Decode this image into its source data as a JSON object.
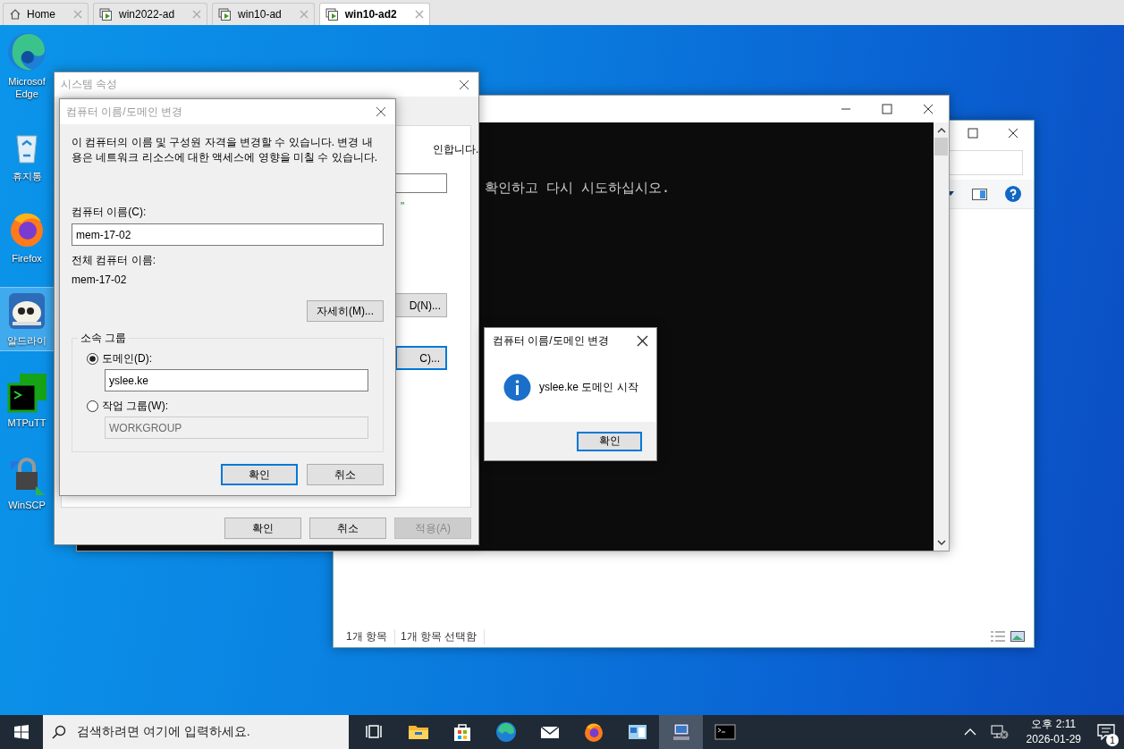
{
  "tabs": [
    {
      "label": "Home",
      "kind": "home",
      "selected": false
    },
    {
      "label": "win2022-ad",
      "kind": "vm",
      "selected": false
    },
    {
      "label": "win10-ad",
      "kind": "vm",
      "selected": false
    },
    {
      "label": "win10-ad2",
      "kind": "vm",
      "selected": true
    }
  ],
  "desktop_icons": [
    {
      "kind": "edge",
      "lines": [
        "Microsof",
        "Edge"
      ],
      "selected": false
    },
    {
      "kind": "recycle",
      "lines": [
        "휴지통"
      ],
      "selected": false
    },
    {
      "kind": "firefox",
      "lines": [
        "Firefox"
      ],
      "selected": false
    },
    {
      "kind": "cloud",
      "lines": [
        "알드라이"
      ],
      "selected": true
    },
    {
      "kind": "terminal",
      "lines": [
        "MTPuTT"
      ],
      "selected": false
    },
    {
      "kind": "lock",
      "lines": [
        "WinSCP"
      ],
      "selected": false
    }
  ],
  "explorer": {
    "status": [
      "1개 항목",
      "1개 항목 선택함"
    ]
  },
  "console": {
    "lines": [
      "확인하고 다시 시도하십시오."
    ]
  },
  "system_properties": {
    "title": "시스템 속성",
    "active": false,
    "fragments": [
      "인합니다.",
      "\""
    ],
    "side_buttons": [
      {
        "label": "D(N)...",
        "focused": false
      },
      {
        "label": "C)...",
        "focused": true
      }
    ],
    "buttons": [
      {
        "label": "확인",
        "disabled": false
      },
      {
        "label": "취소",
        "disabled": false
      },
      {
        "label": "적용(A)",
        "disabled": true
      }
    ]
  },
  "change_dialog": {
    "title": "컴퓨터 이름/도메인 변경",
    "active": false,
    "description": "이 컴퓨터의 이름 및 구성원 자격을 변경할 수 있습니다. 변경 내용은 네트워크 리소스에 대한 액세스에 영향을 미칠 수 있습니다.",
    "computer_name_label": "컴퓨터 이름(C):",
    "computer_name": "mem-17-02",
    "full_name_label": "전체 컴퓨터 이름:",
    "full_name": "mem-17-02",
    "more_button": "자세히(M)...",
    "member_of": {
      "legend": "소속 그룹",
      "options": [
        {
          "label": "도메인(D):",
          "selected": true,
          "value": "yslee.ke"
        },
        {
          "label": "작업 그룹(W):",
          "selected": false,
          "value": "WORKGROUP"
        }
      ]
    },
    "buttons": [
      {
        "label": "확인",
        "focused": true
      },
      {
        "label": "취소",
        "focused": false
      }
    ]
  },
  "message_box": {
    "title": "컴퓨터 이름/도메인 변경",
    "active": true,
    "message": "yslee.ke 도메인 시작",
    "buttons": [
      {
        "label": "확인",
        "focused": true
      }
    ]
  },
  "taskbar": {
    "search_placeholder": "검색하려면 여기에 입력하세요.",
    "apps": [
      {
        "kind": "taskview",
        "active": false
      },
      {
        "kind": "folder",
        "active": false
      },
      {
        "kind": "store",
        "active": false
      },
      {
        "kind": "edge",
        "active": false
      },
      {
        "kind": "mail",
        "active": false
      },
      {
        "kind": "firefox",
        "active": false
      },
      {
        "kind": "panel",
        "active": false
      },
      {
        "kind": "computer",
        "active": true
      },
      {
        "kind": "console",
        "active": false
      }
    ],
    "clock": {
      "time": "오후 2:11",
      "date": "2026-01-29"
    },
    "notification_count": "1"
  }
}
